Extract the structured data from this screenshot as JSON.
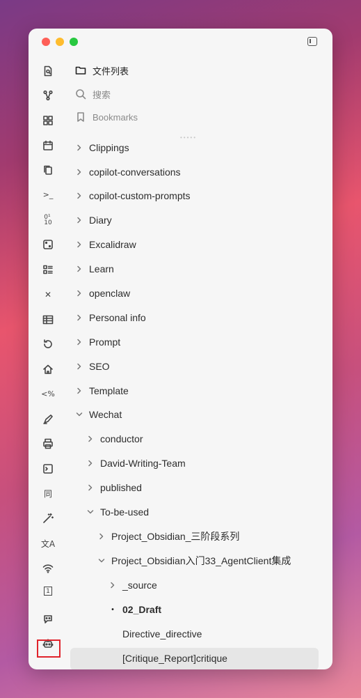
{
  "window": {
    "controls": [
      "close",
      "minimize",
      "zoom"
    ],
    "toggle_icon": "sidebar-toggle-icon"
  },
  "ribbon": {
    "icons": [
      {
        "name": "search-doc-icon",
        "glyph": ""
      },
      {
        "name": "graph-icon",
        "glyph": ""
      },
      {
        "name": "grid-icon",
        "glyph": ""
      },
      {
        "name": "calendar-icon",
        "glyph": ""
      },
      {
        "name": "copy-icon",
        "glyph": ""
      },
      {
        "name": "terminal-icon",
        "glyph": ">_"
      },
      {
        "name": "binary-icon",
        "glyph": "0¹\n10"
      },
      {
        "name": "dice-icon",
        "glyph": ""
      },
      {
        "name": "list-icon",
        "glyph": ""
      },
      {
        "name": "tools-icon",
        "glyph": "✕"
      },
      {
        "name": "table-icon",
        "glyph": ""
      },
      {
        "name": "history-icon",
        "glyph": ""
      },
      {
        "name": "home-icon",
        "glyph": ""
      },
      {
        "name": "code-percent-icon",
        "glyph": "<%"
      },
      {
        "name": "pen-icon",
        "glyph": ""
      },
      {
        "name": "print-icon",
        "glyph": ""
      },
      {
        "name": "console-icon",
        "glyph": ""
      },
      {
        "name": "sync-char-icon",
        "glyph": "同"
      },
      {
        "name": "magic-wand-icon",
        "glyph": ""
      },
      {
        "name": "translate-icon",
        "glyph": "文A"
      },
      {
        "name": "wifi-icon",
        "glyph": ""
      },
      {
        "name": "calendar-day-icon",
        "glyph": "1"
      },
      {
        "name": "bot-chat-icon",
        "glyph": ""
      },
      {
        "name": "bot-icon",
        "glyph": ""
      }
    ]
  },
  "nav": {
    "files_label": "文件列表",
    "search_label": "搜索",
    "bookmarks_label": "Bookmarks"
  },
  "tree": [
    {
      "label": "Clippings",
      "depth": 0,
      "kind": "collapsed"
    },
    {
      "label": "copilot-conversations",
      "depth": 0,
      "kind": "collapsed"
    },
    {
      "label": "copilot-custom-prompts",
      "depth": 0,
      "kind": "collapsed"
    },
    {
      "label": "Diary",
      "depth": 0,
      "kind": "collapsed"
    },
    {
      "label": "Excalidraw",
      "depth": 0,
      "kind": "collapsed"
    },
    {
      "label": "Learn",
      "depth": 0,
      "kind": "collapsed"
    },
    {
      "label": "openclaw",
      "depth": 0,
      "kind": "collapsed"
    },
    {
      "label": "Personal info",
      "depth": 0,
      "kind": "collapsed"
    },
    {
      "label": "Prompt",
      "depth": 0,
      "kind": "collapsed"
    },
    {
      "label": "SEO",
      "depth": 0,
      "kind": "collapsed"
    },
    {
      "label": "Template",
      "depth": 0,
      "kind": "collapsed"
    },
    {
      "label": "Wechat",
      "depth": 0,
      "kind": "expanded"
    },
    {
      "label": "conductor",
      "depth": 1,
      "kind": "collapsed"
    },
    {
      "label": "David-Writing-Team",
      "depth": 1,
      "kind": "collapsed"
    },
    {
      "label": "published",
      "depth": 1,
      "kind": "collapsed"
    },
    {
      "label": "To-be-used",
      "depth": 1,
      "kind": "expanded"
    },
    {
      "label": "Project_Obsidian_三阶段系列",
      "depth": 2,
      "kind": "collapsed"
    },
    {
      "label": "Project_Obsidian入门33_AgentClient集成",
      "depth": 2,
      "kind": "expanded"
    },
    {
      "label": "_source",
      "depth": 3,
      "kind": "collapsed"
    },
    {
      "label": "02_Draft",
      "depth": 3,
      "kind": "bullet"
    },
    {
      "label": "Directive_directive",
      "depth": 3,
      "kind": "file"
    },
    {
      "label": "[Critique_Report]critique",
      "depth": 3,
      "kind": "file-selected"
    }
  ]
}
